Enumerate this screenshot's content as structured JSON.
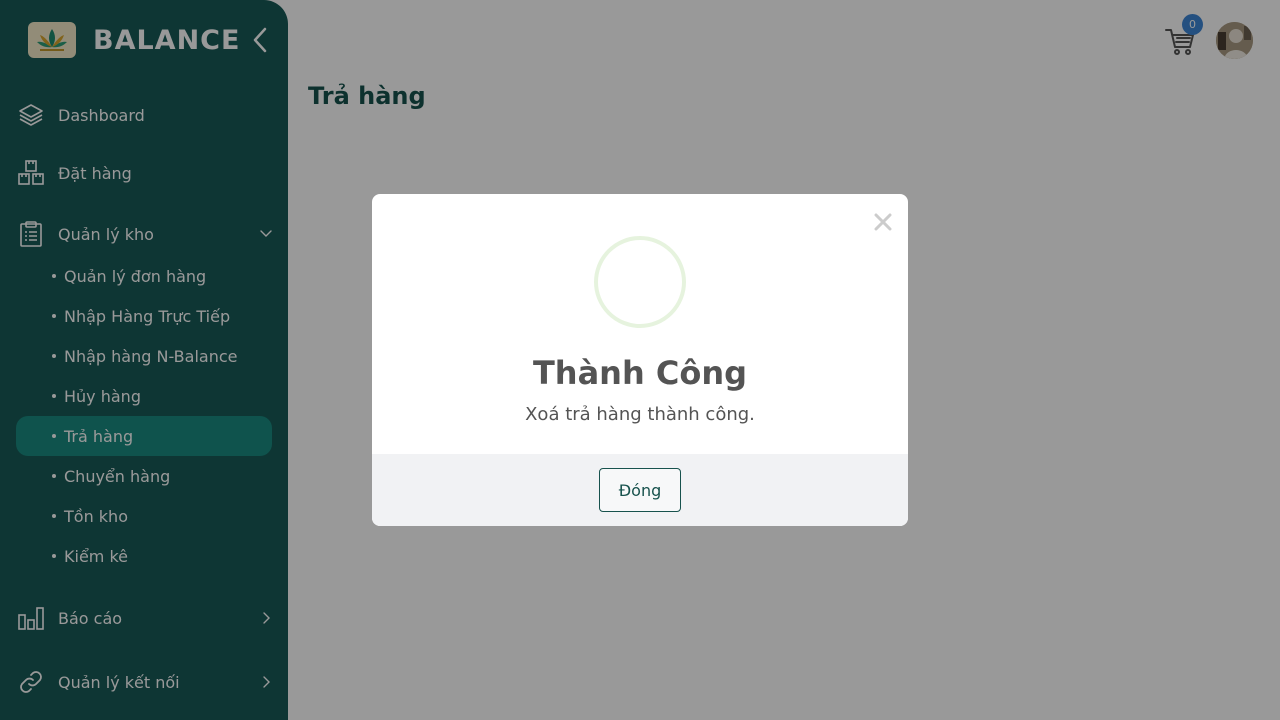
{
  "brand": {
    "name": "BALANCE",
    "logo_icon": "lotus-logo-icon"
  },
  "sidebar": {
    "items": [
      {
        "label": "Dashboard",
        "icon": "layers-icon"
      },
      {
        "label": "Đặt hàng",
        "icon": "boxes-icon"
      },
      {
        "label": "Quản lý kho",
        "icon": "clipboard-icon",
        "expanded": true
      },
      {
        "label": "Báo cáo",
        "icon": "bar-chart-icon"
      },
      {
        "label": "Quản lý kết nối",
        "icon": "link-icon"
      }
    ],
    "subitems": [
      {
        "label": "Quản lý đơn hàng"
      },
      {
        "label": "Nhập Hàng Trực Tiếp"
      },
      {
        "label": "Nhập hàng N-Balance"
      },
      {
        "label": "Hủy hàng"
      },
      {
        "label": "Trả hàng",
        "active": true
      },
      {
        "label": "Chuyển hàng"
      },
      {
        "label": "Tồn kho"
      },
      {
        "label": "Kiểm kê"
      }
    ]
  },
  "header": {
    "cart_count": "0"
  },
  "main": {
    "page_title": "Trả hàng"
  },
  "modal": {
    "title": "Thành Công",
    "message": "Xoá trả hàng thành công.",
    "close_button": "Đóng"
  },
  "colors": {
    "sidebar_bg": "#185a57",
    "accent": "#17524d",
    "active_item": "#1a8a80",
    "badge": "#3d86d6"
  }
}
